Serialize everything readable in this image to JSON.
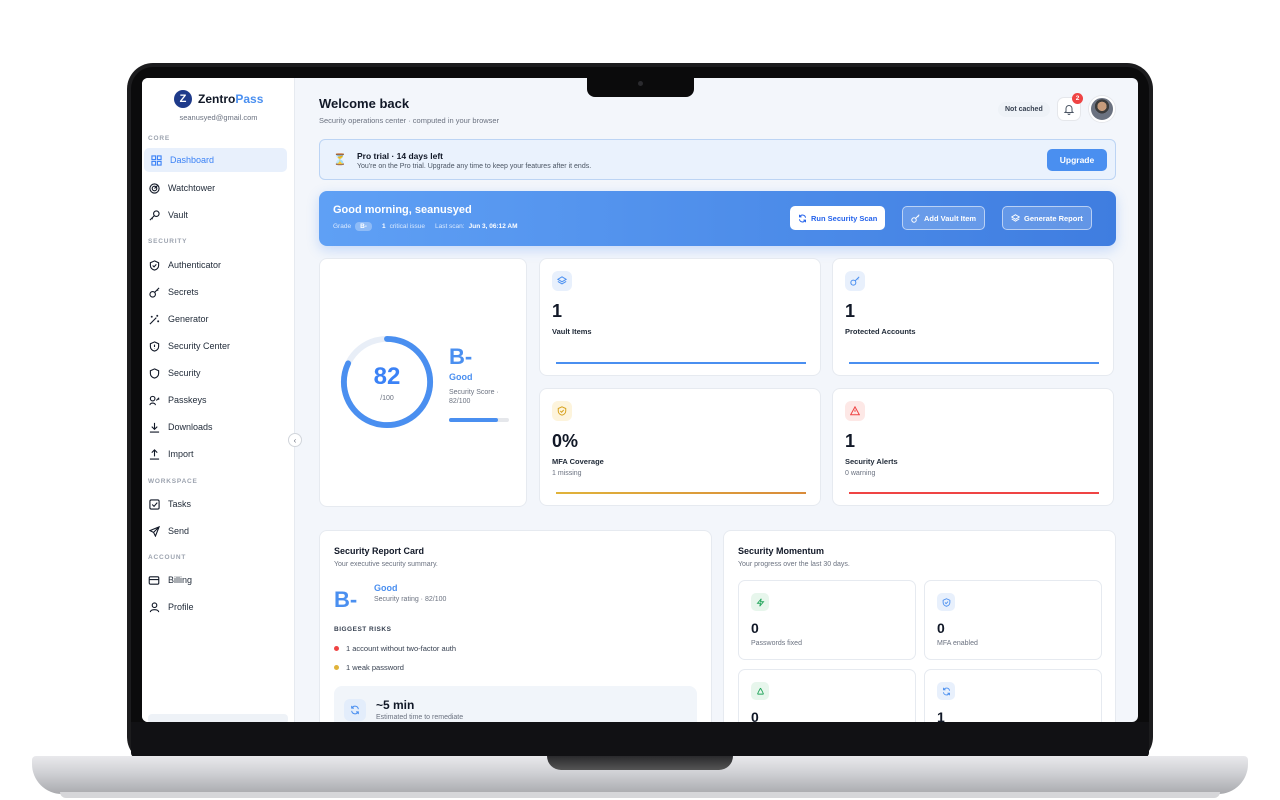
{
  "brand": {
    "name_a": "Zentro",
    "name_b": "Pass",
    "logo_letter": "Z",
    "email": "seanusyed@gmail.com"
  },
  "sidebar": {
    "sections": [
      "CORE",
      "SECURITY",
      "WORKSPACE",
      "ACCOUNT"
    ],
    "items": [
      {
        "label": "Dashboard",
        "icon": "grid-icon"
      },
      {
        "label": "Watchtower",
        "icon": "radar-icon"
      },
      {
        "label": "Vault",
        "icon": "key-icon"
      },
      {
        "label": "Authenticator",
        "icon": "shield-check-icon"
      },
      {
        "label": "Secrets",
        "icon": "key-icon"
      },
      {
        "label": "Generator",
        "icon": "wand-icon"
      },
      {
        "label": "Security Center",
        "icon": "shield-alert-icon"
      },
      {
        "label": "Security",
        "icon": "shield-icon"
      },
      {
        "label": "Passkeys",
        "icon": "passkey-icon"
      },
      {
        "label": "Downloads",
        "icon": "download-icon"
      },
      {
        "label": "Import",
        "icon": "upload-icon"
      },
      {
        "label": "Tasks",
        "icon": "checkbox-icon"
      },
      {
        "label": "Send",
        "icon": "send-icon"
      },
      {
        "label": "Billing",
        "icon": "card-icon"
      },
      {
        "label": "Profile",
        "icon": "user-icon"
      }
    ]
  },
  "header": {
    "title": "Welcome back",
    "subtitle": "Security operations center · computed in your browser",
    "cache_badge": "Not cached",
    "notifications": "2"
  },
  "trial": {
    "title": "Pro trial · 14 days left",
    "subtitle": "You're on the Pro trial. Upgrade any time to keep your features after it ends.",
    "button": "Upgrade"
  },
  "hero": {
    "greeting": "Good morning, seanusyed",
    "grade_label": "Grade",
    "grade": "B-",
    "critical": "1",
    "critical_label": "critical issue",
    "last_scan_label": "Last scan:",
    "last_scan": "Jun 3, 06:12 AM",
    "buttons": {
      "scan": "Run Security Scan",
      "add": "Add Vault Item",
      "report": "Generate Report"
    }
  },
  "score": {
    "value": "82",
    "of": "/100",
    "grade": "B-",
    "grade_word": "Good",
    "label": "Security Score · 82/100",
    "fraction": 0.82
  },
  "stats": [
    {
      "value": "1",
      "label": "Vault Items",
      "sub": "",
      "icon": "layers-icon",
      "color": "#4a8ff0"
    },
    {
      "value": "1",
      "label": "Protected Accounts",
      "sub": "",
      "icon": "key-icon",
      "color": "#4a8ff0"
    },
    {
      "value": "0%",
      "label": "MFA Coverage",
      "sub": "1 missing",
      "icon": "shield-icon",
      "color": "#e0b33a"
    },
    {
      "value": "1",
      "label": "Security Alerts",
      "sub": "0 warning",
      "icon": "alert-triangle-icon",
      "color": "#ef4444"
    }
  ],
  "report": {
    "title": "Security Report Card",
    "subtitle": "Your executive security summary.",
    "grade": "B-",
    "grade_word": "Good",
    "rating": "Security rating · 82/100",
    "risks_heading": "BIGGEST RISKS",
    "risks": [
      {
        "text": "1 account without two-factor auth",
        "color": "#ef4444"
      },
      {
        "text": "1 weak password",
        "color": "#e0b33a"
      }
    ],
    "remediate_value": "~5 min",
    "remediate_label": "Estimated time to remediate"
  },
  "momentum": {
    "title": "Security Momentum",
    "subtitle": "Your progress over the last 30 days.",
    "tiles": [
      {
        "value": "0",
        "label": "Passwords fixed",
        "icon": "bolt-icon"
      },
      {
        "value": "0",
        "label": "MFA enabled",
        "icon": "shield-icon"
      },
      {
        "value": "0",
        "label": "",
        "icon": "recycle-icon"
      },
      {
        "value": "1",
        "label": "",
        "icon": "refresh-icon"
      }
    ]
  }
}
